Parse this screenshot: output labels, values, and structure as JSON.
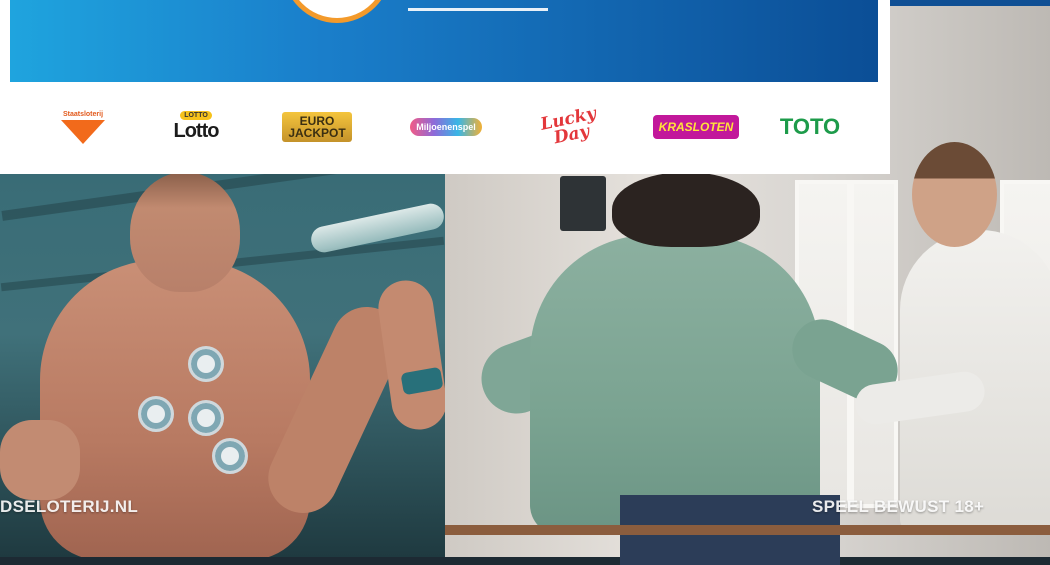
{
  "footer": {
    "website_text": "DSELOTERIJ.NL",
    "responsible_play_text": "SPEEL BEWUST 18+"
  },
  "brand_logos": [
    {
      "label": "Staatsloterij",
      "icon": "staatsloterij-logo",
      "color": "#f26a1b"
    },
    {
      "label": "Lotto",
      "badge": "LOTTO",
      "icon": "lotto-logo",
      "color": "#1c1c1c"
    },
    {
      "label": "EURO JACKPOT",
      "icon": "eurojackpot-logo",
      "color": "#c4922a"
    },
    {
      "label": "Miljoenenspel",
      "icon": "miljoenenspel-logo",
      "color": "#8d6ad9"
    },
    {
      "label": "Lucky Day",
      "icon": "luckyday-logo",
      "color": "#e3373b"
    },
    {
      "label": "KRASLOTEN",
      "icon": "krasloten-logo",
      "color": "#c2189b"
    },
    {
      "label": "TOTO",
      "icon": "toto-logo",
      "color": "#1d9b4a"
    }
  ],
  "banner": {
    "background_colors": [
      "#1fa4de",
      "#0b4e96"
    ],
    "logo_ring_color": "#f39a2b"
  }
}
